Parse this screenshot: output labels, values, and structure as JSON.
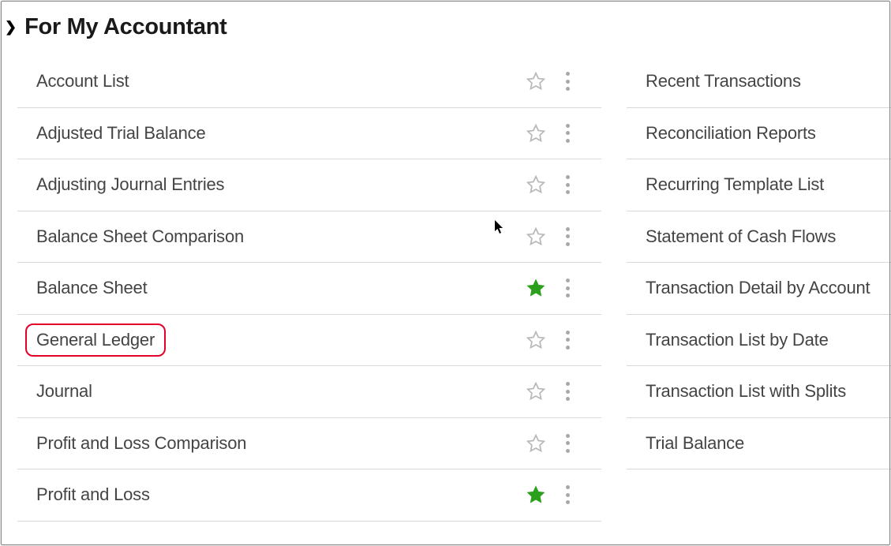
{
  "section": {
    "title": "For My Accountant"
  },
  "leftReports": [
    {
      "label": "Account List",
      "starred": false,
      "highlighted": false
    },
    {
      "label": "Adjusted Trial Balance",
      "starred": false,
      "highlighted": false
    },
    {
      "label": "Adjusting Journal Entries",
      "starred": false,
      "highlighted": false
    },
    {
      "label": "Balance Sheet Comparison",
      "starred": false,
      "highlighted": false
    },
    {
      "label": "Balance Sheet",
      "starred": true,
      "highlighted": false
    },
    {
      "label": "General Ledger",
      "starred": false,
      "highlighted": true
    },
    {
      "label": "Journal",
      "starred": false,
      "highlighted": false
    },
    {
      "label": "Profit and Loss Comparison",
      "starred": false,
      "highlighted": false
    },
    {
      "label": "Profit and Loss",
      "starred": true,
      "highlighted": false
    }
  ],
  "rightReports": [
    {
      "label": "Recent Transactions"
    },
    {
      "label": "Reconciliation Reports"
    },
    {
      "label": "Recurring Template List"
    },
    {
      "label": "Statement of Cash Flows"
    },
    {
      "label": "Transaction Detail by Account"
    },
    {
      "label": "Transaction List by Date"
    },
    {
      "label": "Transaction List with Splits"
    },
    {
      "label": "Trial Balance"
    }
  ],
  "colors": {
    "star_filled": "#2ca01c",
    "star_outline": "#b8b8b8",
    "highlight_border": "#e4002b"
  }
}
